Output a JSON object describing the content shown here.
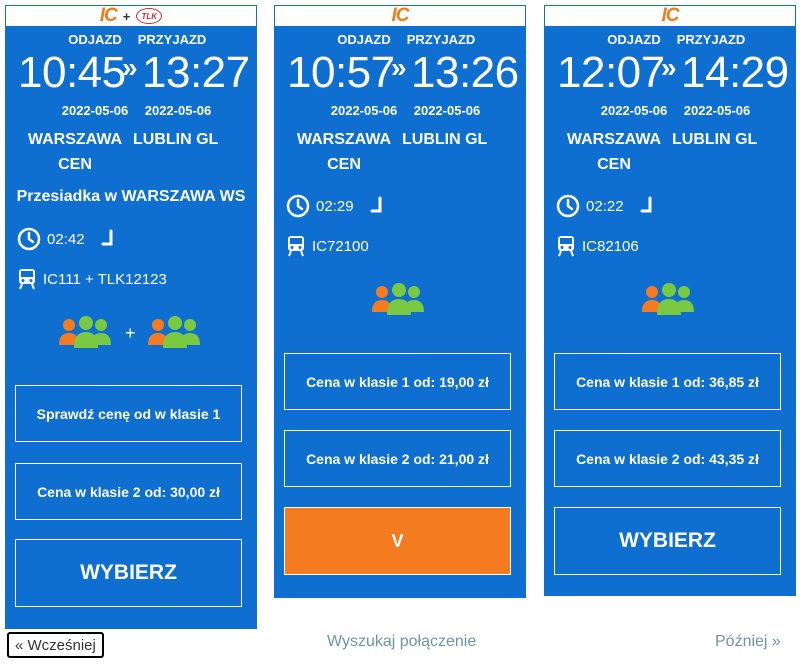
{
  "labels": {
    "departure": "ODJAZD",
    "arrival": "PRZYJAZD",
    "ic_logo": "IC",
    "tlk_logo": "TLK",
    "plus": "+"
  },
  "cards": [
    {
      "dep_time": "10:45",
      "arr_time": "13:27",
      "arrow": "»",
      "dep_date": "2022-05-06",
      "arr_date": "2022-05-06",
      "dep_station": "WARSZAWA CEN",
      "arr_station": "LUBLIN GL",
      "transfer": "Przesiadka w WARSZAWA WS",
      "duration": "02:42",
      "trains": "IC111 + TLK12123",
      "price_1": "Sprawdź cenę od w klasie 1",
      "price_2": "Cena w klasie 2 od: 30,00 zł",
      "select": "WYBIERZ"
    },
    {
      "dep_time": "10:57",
      "arr_time": "13:26",
      "arrow": "»",
      "dep_date": "2022-05-06",
      "arr_date": "2022-05-06",
      "dep_station": "WARSZAWA CEN",
      "arr_station": "LUBLIN GL",
      "duration": "02:29",
      "trains": "IC72100",
      "price_1": "Cena w klasie 1 od: 19,00 zł",
      "price_2": "Cena w klasie 2 od: 21,00 zł",
      "select": "V"
    },
    {
      "dep_time": "12:07",
      "arr_time": "14:29",
      "arrow": "»",
      "dep_date": "2022-05-06",
      "arr_date": "2022-05-06",
      "dep_station": "WARSZAWA CEN",
      "arr_station": "LUBLIN GL",
      "duration": "02:22",
      "trains": "IC82106",
      "price_1": "Cena w klasie 1 od: 36,85 zł",
      "price_2": "Cena w klasie 2 od: 43,35 zł",
      "select": "WYBIERZ"
    }
  ],
  "footer": {
    "prev": "« Wcześniej",
    "search": "Wyszukaj połączenie",
    "next": "Później »"
  },
  "colors": {
    "card_bg": "#0f6fd0",
    "accent_orange": "#f47b20",
    "link": "#6e95a6"
  },
  "icons": {
    "clock": "clock-icon",
    "train": "train-icon",
    "seat": "seat-icon",
    "group": "passenger-group-icon"
  }
}
